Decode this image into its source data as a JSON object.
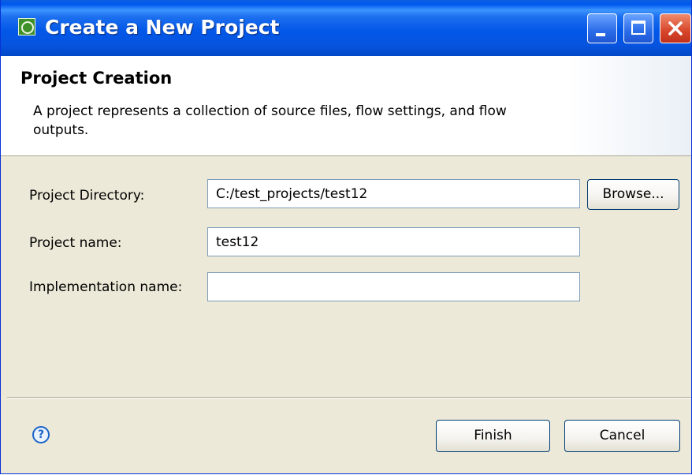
{
  "window": {
    "title": "Create a New Project"
  },
  "banner": {
    "title": "Project Creation",
    "description": "A project represents a collection of source files, flow settings, and flow outputs."
  },
  "form": {
    "directory_label": "Project Directory:",
    "directory_value": "C:/test_projects/test12",
    "browse_label": "Browse...",
    "name_label": "Project name:",
    "name_value": "test12",
    "impl_label": "Implementation name:",
    "impl_value": ""
  },
  "footer": {
    "help_symbol": "?",
    "finish_label": "Finish",
    "cancel_label": "Cancel"
  },
  "colors": {
    "titlebar": "#0058ee",
    "close_button": "#d7452a",
    "dialog_background": "#ece9d8"
  },
  "icons": [
    "app-icon",
    "minimize-icon",
    "maximize-icon",
    "close-icon",
    "help-icon"
  ]
}
